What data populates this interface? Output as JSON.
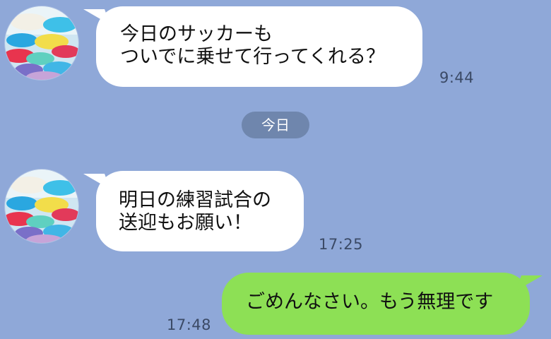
{
  "messages": [
    {
      "direction": "incoming",
      "lines": [
        "今日のサッカーも",
        "ついでに乗せて行ってくれる？"
      ],
      "time": "9:44"
    },
    {
      "direction": "incoming",
      "lines": [
        "明日の練習試合の",
        "送迎もお願い！"
      ],
      "time": "17:25"
    },
    {
      "direction": "outgoing",
      "lines": [
        "ごめんなさい。もう無理です"
      ],
      "time": "17:48"
    }
  ],
  "date_separator": "今日",
  "colors": {
    "background": "#8fa8d8",
    "incoming_bubble": "#ffffff",
    "outgoing_bubble": "#8de055",
    "date_pill": "#6f86ad",
    "time_text": "#3b4a66"
  },
  "icons": {
    "avatar": "umbrella-photo-avatar-icon"
  }
}
